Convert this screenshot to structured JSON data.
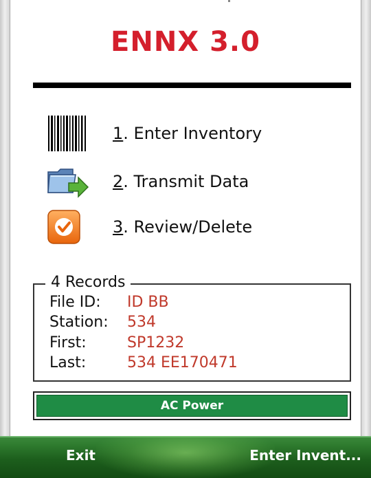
{
  "app": {
    "title": "ENNX 3.0",
    "accent_color": "#d41f2c"
  },
  "menu": {
    "items": [
      {
        "number": "1",
        "label": ". Enter Inventory",
        "icon": "barcode-icon"
      },
      {
        "number": "2",
        "label": ". Transmit Data",
        "icon": "folder-transfer-icon"
      },
      {
        "number": "3",
        "label": ". Review/Delete",
        "icon": "checkmark-icon"
      }
    ]
  },
  "records": {
    "legend": "4 Records",
    "rows": [
      {
        "label": "File ID:",
        "value": "ID BB"
      },
      {
        "label": "Station:",
        "value": "534"
      },
      {
        "label": "First:",
        "value": "SP1232"
      },
      {
        "label": "Last:",
        "value": "534 EE170471"
      }
    ],
    "value_color": "#c0392b"
  },
  "power": {
    "label": "AC Power",
    "color": "#1f8c45"
  },
  "softkeys": {
    "left": "Exit",
    "right": "Enter Invent..."
  }
}
